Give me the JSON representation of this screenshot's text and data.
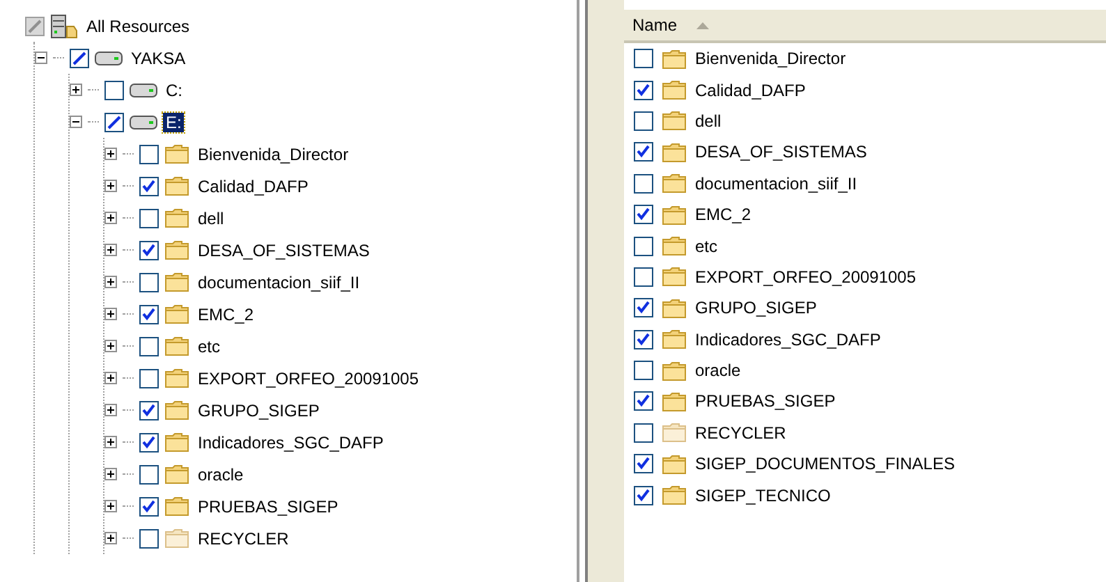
{
  "tree": {
    "label": "All Resources",
    "kind": "resources",
    "checked": false,
    "indeterminate": true,
    "disabled": true,
    "selected": false,
    "children": [
      {
        "label": "YAKSA",
        "kind": "drive",
        "checked": false,
        "indeterminate": true,
        "expanded": true,
        "selected": false,
        "children": [
          {
            "label": "C:",
            "kind": "drive",
            "checked": false,
            "indeterminate": false,
            "expanded": false,
            "selected": false
          },
          {
            "label": "E:",
            "kind": "drive",
            "checked": false,
            "indeterminate": true,
            "expanded": true,
            "selected": true,
            "children": [
              {
                "label": "Bienvenida_Director",
                "kind": "folder",
                "checked": false,
                "indeterminate": false,
                "expanded": false,
                "selected": false
              },
              {
                "label": "Calidad_DAFP",
                "kind": "folder",
                "checked": true,
                "indeterminate": false,
                "expanded": false,
                "selected": false
              },
              {
                "label": "dell",
                "kind": "folder",
                "checked": false,
                "indeterminate": false,
                "expanded": false,
                "selected": false
              },
              {
                "label": "DESA_OF_SISTEMAS",
                "kind": "folder",
                "checked": true,
                "indeterminate": false,
                "expanded": false,
                "selected": false
              },
              {
                "label": "documentacion_siif_II",
                "kind": "folder",
                "checked": false,
                "indeterminate": false,
                "expanded": false,
                "selected": false
              },
              {
                "label": "EMC_2",
                "kind": "folder",
                "checked": true,
                "indeterminate": false,
                "expanded": false,
                "selected": false
              },
              {
                "label": "etc",
                "kind": "folder",
                "checked": false,
                "indeterminate": false,
                "expanded": false,
                "selected": false
              },
              {
                "label": "EXPORT_ORFEO_20091005",
                "kind": "folder",
                "checked": false,
                "indeterminate": false,
                "expanded": false,
                "selected": false
              },
              {
                "label": "GRUPO_SIGEP",
                "kind": "folder",
                "checked": true,
                "indeterminate": false,
                "expanded": false,
                "selected": false
              },
              {
                "label": "Indicadores_SGC_DAFP",
                "kind": "folder",
                "checked": true,
                "indeterminate": false,
                "expanded": false,
                "selected": false
              },
              {
                "label": "oracle",
                "kind": "folder",
                "checked": false,
                "indeterminate": false,
                "expanded": false,
                "selected": false
              },
              {
                "label": "PRUEBAS_SIGEP",
                "kind": "folder",
                "checked": true,
                "indeterminate": false,
                "expanded": false,
                "selected": false
              },
              {
                "label": "RECYCLER",
                "kind": "hidden_folder",
                "checked": false,
                "indeterminate": false,
                "expanded": false,
                "selected": false
              }
            ]
          }
        ]
      }
    ]
  },
  "list": {
    "header": {
      "label": "Name",
      "sorted_ascending": true
    },
    "rows": [
      {
        "label": "Bienvenida_Director",
        "kind": "folder",
        "checked": false
      },
      {
        "label": "Calidad_DAFP",
        "kind": "folder",
        "checked": true
      },
      {
        "label": "dell",
        "kind": "folder",
        "checked": false
      },
      {
        "label": "DESA_OF_SISTEMAS",
        "kind": "folder",
        "checked": true
      },
      {
        "label": "documentacion_siif_II",
        "kind": "folder",
        "checked": false
      },
      {
        "label": "EMC_2",
        "kind": "folder",
        "checked": true
      },
      {
        "label": "etc",
        "kind": "folder",
        "checked": false
      },
      {
        "label": "EXPORT_ORFEO_20091005",
        "kind": "folder",
        "checked": false
      },
      {
        "label": "GRUPO_SIGEP",
        "kind": "folder",
        "checked": true
      },
      {
        "label": "Indicadores_SGC_DAFP",
        "kind": "folder",
        "checked": true
      },
      {
        "label": "oracle",
        "kind": "folder",
        "checked": false
      },
      {
        "label": "PRUEBAS_SIGEP",
        "kind": "folder",
        "checked": true
      },
      {
        "label": "RECYCLER",
        "kind": "hidden_folder",
        "checked": false
      },
      {
        "label": "SIGEP_DOCUMENTOS_FINALES",
        "kind": "folder",
        "checked": true
      },
      {
        "label": "SIGEP_TECNICO",
        "kind": "folder",
        "checked": true
      }
    ]
  }
}
